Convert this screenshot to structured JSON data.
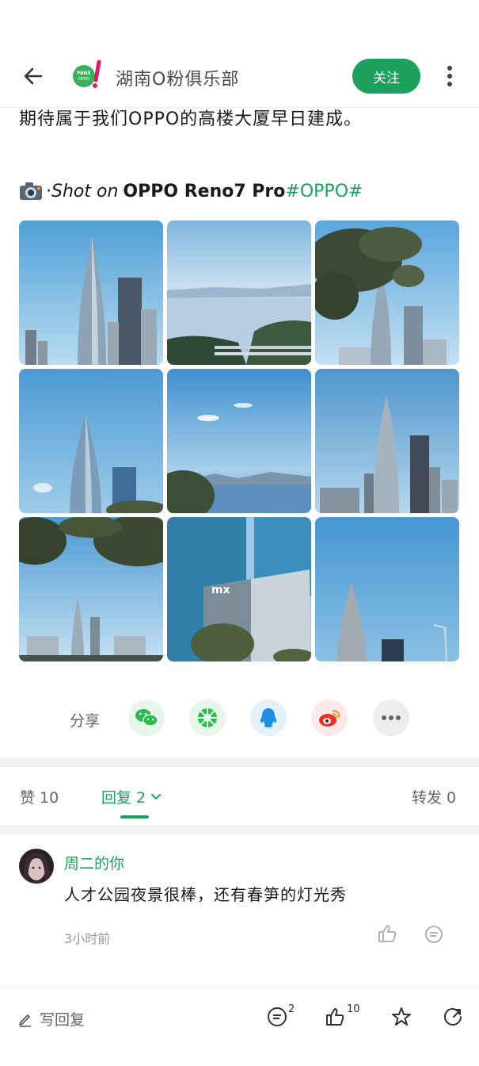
{
  "header": {
    "club_name": "湖南O粉俱乐部",
    "follow_label": "关注",
    "logo_text": "OPPO FANS",
    "accent": "#1ca15c"
  },
  "post": {
    "text": "期待属于我们OPPO的高楼大厦早日建成。",
    "shot_prefix": "· ",
    "shot_on": "Shot on",
    "device": "OPPO Reno7 Pro",
    "hashtag": "#OPPO#",
    "photos": [
      "tower-close-up",
      "coastline-bridge",
      "tree-and-tower",
      "tower-sky",
      "sea-view",
      "towers-skyline",
      "trees-skyline",
      "office-building",
      "tower-tip"
    ]
  },
  "share": {
    "label": "分享",
    "targets": [
      "wechat-icon",
      "moments-icon",
      "qq-icon",
      "weibo-icon",
      "more-icon"
    ]
  },
  "stats": {
    "likes_label": "赞 10",
    "replies_label": "回复 2",
    "reposts_label": "转发 0"
  },
  "comment": {
    "user": "周二的你",
    "text": "人才公园夜景很棒，还有春笋的灯光秀",
    "time": "3小时前"
  },
  "bottom": {
    "write_reply": "写回复",
    "comment_count": "2",
    "like_count": "10"
  }
}
